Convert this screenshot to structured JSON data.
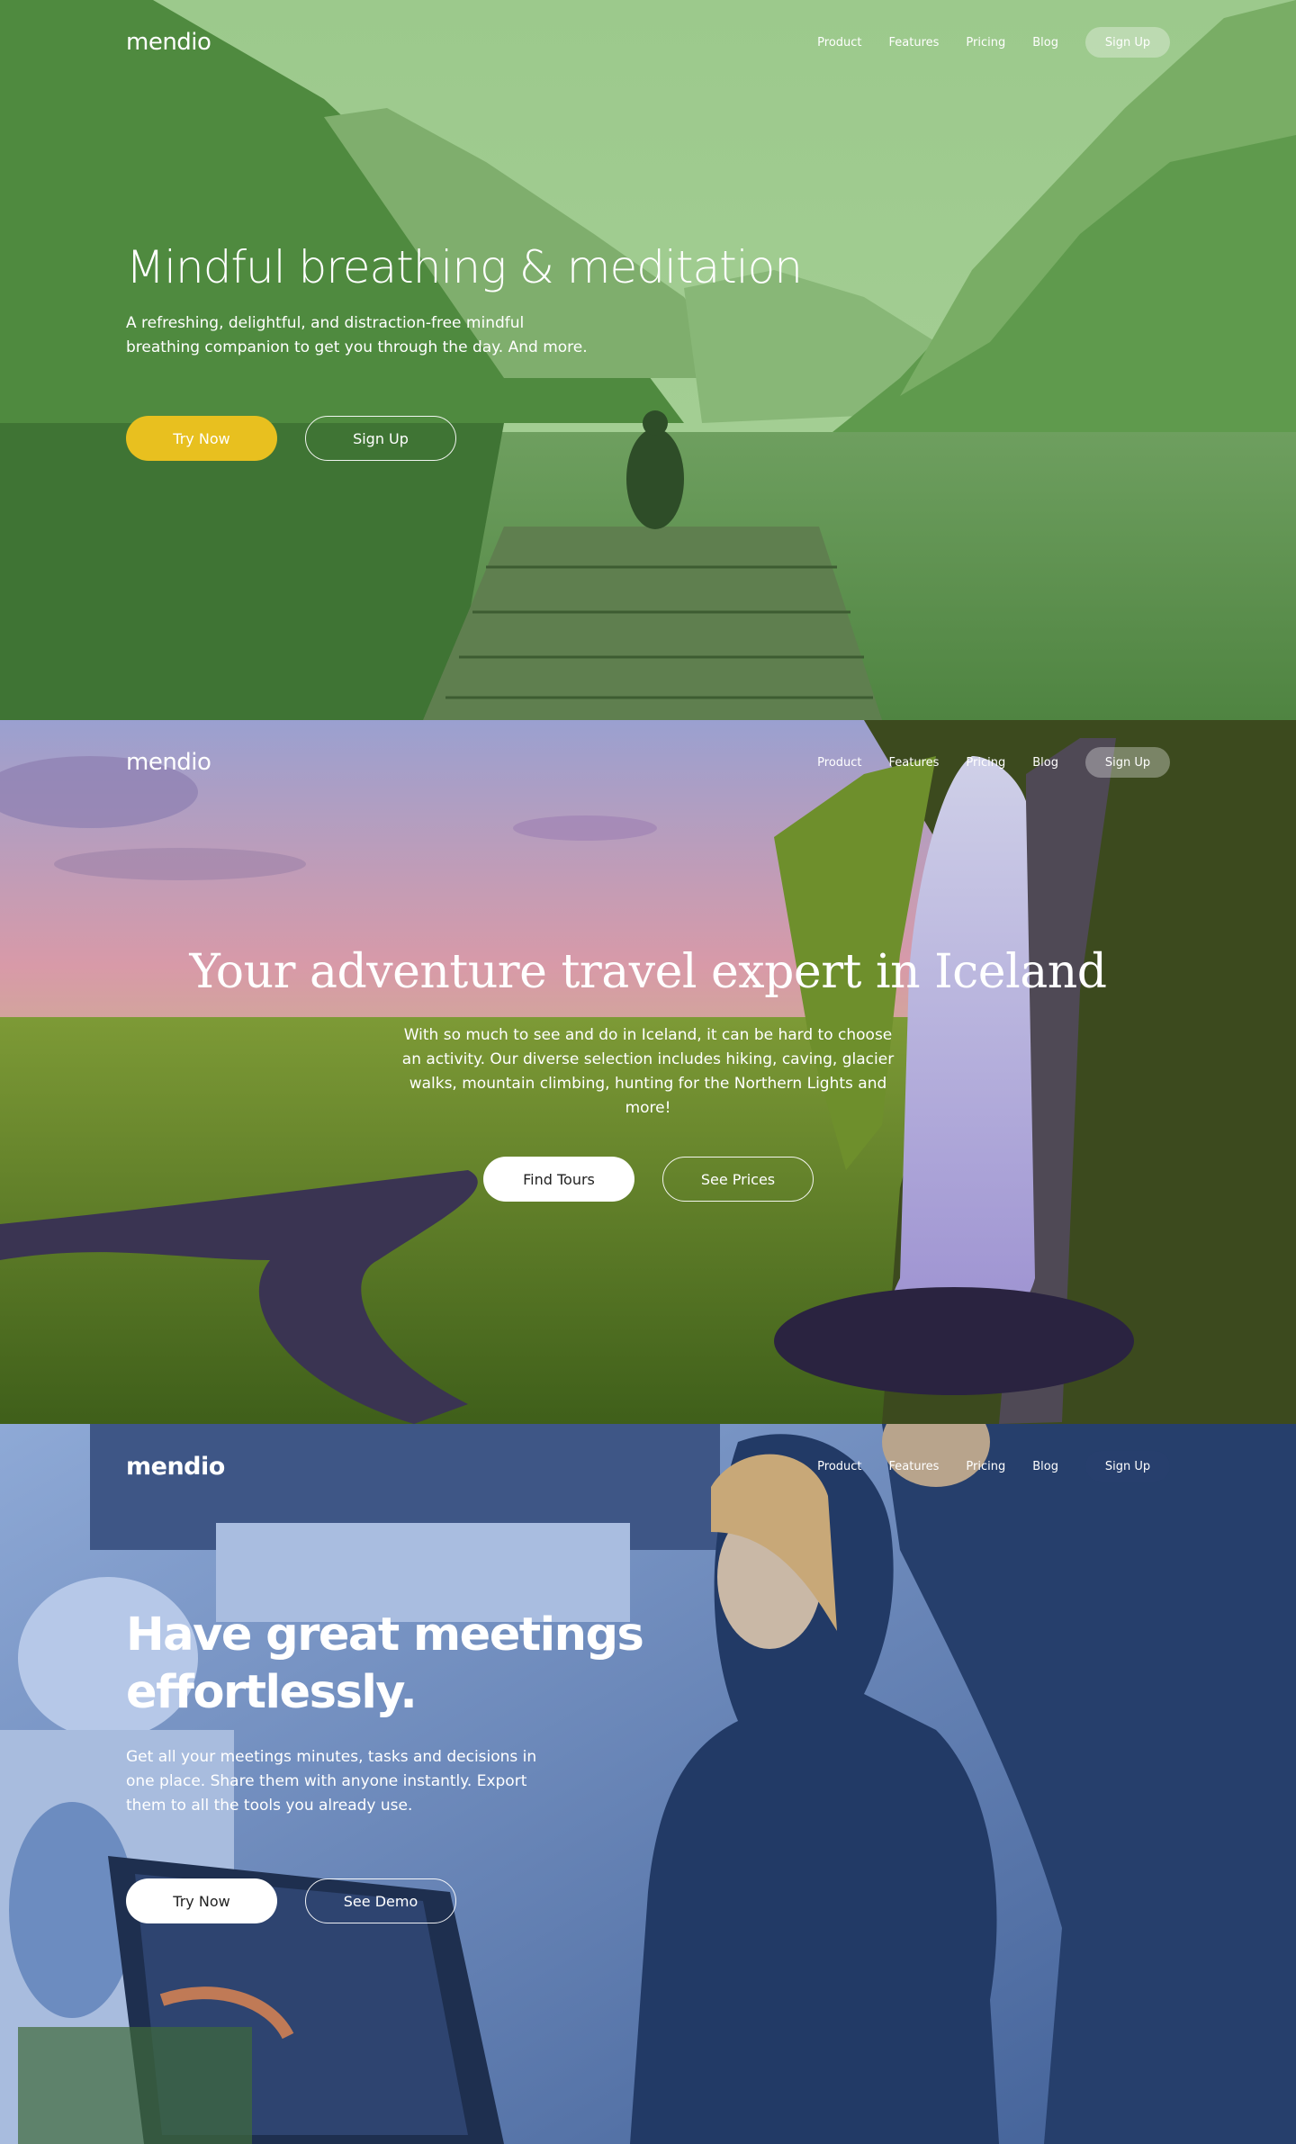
{
  "hero1": {
    "logo": "mendio",
    "nav": [
      "Product",
      "Features",
      "Pricing",
      "Blog"
    ],
    "signup_label": "Sign Up",
    "title": "Mindful breathing & meditation",
    "subtitle": "A refreshing, delightful, and distraction-free mindful breathing companion to get you through the day. And more.",
    "primary_button": "Try Now",
    "secondary_button": "Sign Up",
    "accent_color": "#e8c01f",
    "overlay_color": "#5a9a4c"
  },
  "hero2": {
    "logo": "mendio",
    "nav": [
      "Product",
      "Features",
      "Pricing",
      "Blog"
    ],
    "signup_label": "Sign Up",
    "title": "Your adventure travel expert in Iceland",
    "subtitle": "With so much to see and do in Iceland, it can be hard to choose an activity. Our diverse selection includes hiking, caving, glacier walks, mountain climbing, hunting for the Northern Lights and more!",
    "primary_button": "Find Tours",
    "secondary_button": "See Prices"
  },
  "hero3": {
    "logo": "mendio",
    "nav": [
      "Product",
      "Features",
      "Pricing",
      "Blog"
    ],
    "signup_label": "Sign Up",
    "title": "Have great meetings effortlessly.",
    "subtitle": "Get all your meetings minutes, tasks and decisions in one place. Share them with anyone instantly. Export them to all the tools you already use.",
    "primary_button": "Try Now",
    "secondary_button": "See Demo",
    "overlay_color": "#3d5f9c"
  }
}
